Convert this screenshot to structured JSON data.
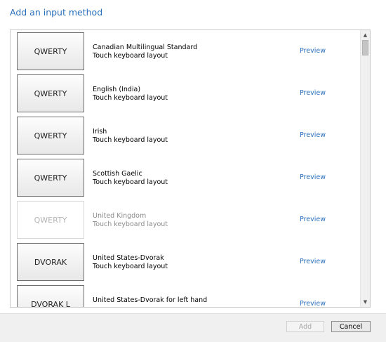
{
  "dialog": {
    "title": "Add an input method"
  },
  "layouts": [
    {
      "tile": "QWERTY",
      "name": "Canadian Multilingual Standard",
      "type": "Touch keyboard layout",
      "preview": "Preview",
      "disabled": false
    },
    {
      "tile": "QWERTY",
      "name": "English (India)",
      "type": "Touch keyboard layout",
      "preview": "Preview",
      "disabled": false
    },
    {
      "tile": "QWERTY",
      "name": "Irish",
      "type": "Touch keyboard layout",
      "preview": "Preview",
      "disabled": false
    },
    {
      "tile": "QWERTY",
      "name": "Scottish Gaelic",
      "type": "Touch keyboard layout",
      "preview": "Preview",
      "disabled": false
    },
    {
      "tile": "QWERTY",
      "name": "United Kingdom",
      "type": "Touch keyboard layout",
      "preview": "Preview",
      "disabled": true
    },
    {
      "tile": "DVORAK",
      "name": "United States-Dvorak",
      "type": "Touch keyboard layout",
      "preview": "Preview",
      "disabled": false
    },
    {
      "tile": "DVORAK L",
      "name": "United States-Dvorak for left hand",
      "type": "",
      "preview": "Preview",
      "disabled": false
    }
  ],
  "scrollbar": {
    "up_icon": "chevron-up-icon",
    "down_icon": "chevron-down-icon"
  },
  "buttons": {
    "add_label": "Add",
    "add_enabled": false,
    "cancel_label": "Cancel"
  },
  "colors": {
    "accent": "#2a6fba",
    "disabled_text": "#8c8c8c"
  }
}
